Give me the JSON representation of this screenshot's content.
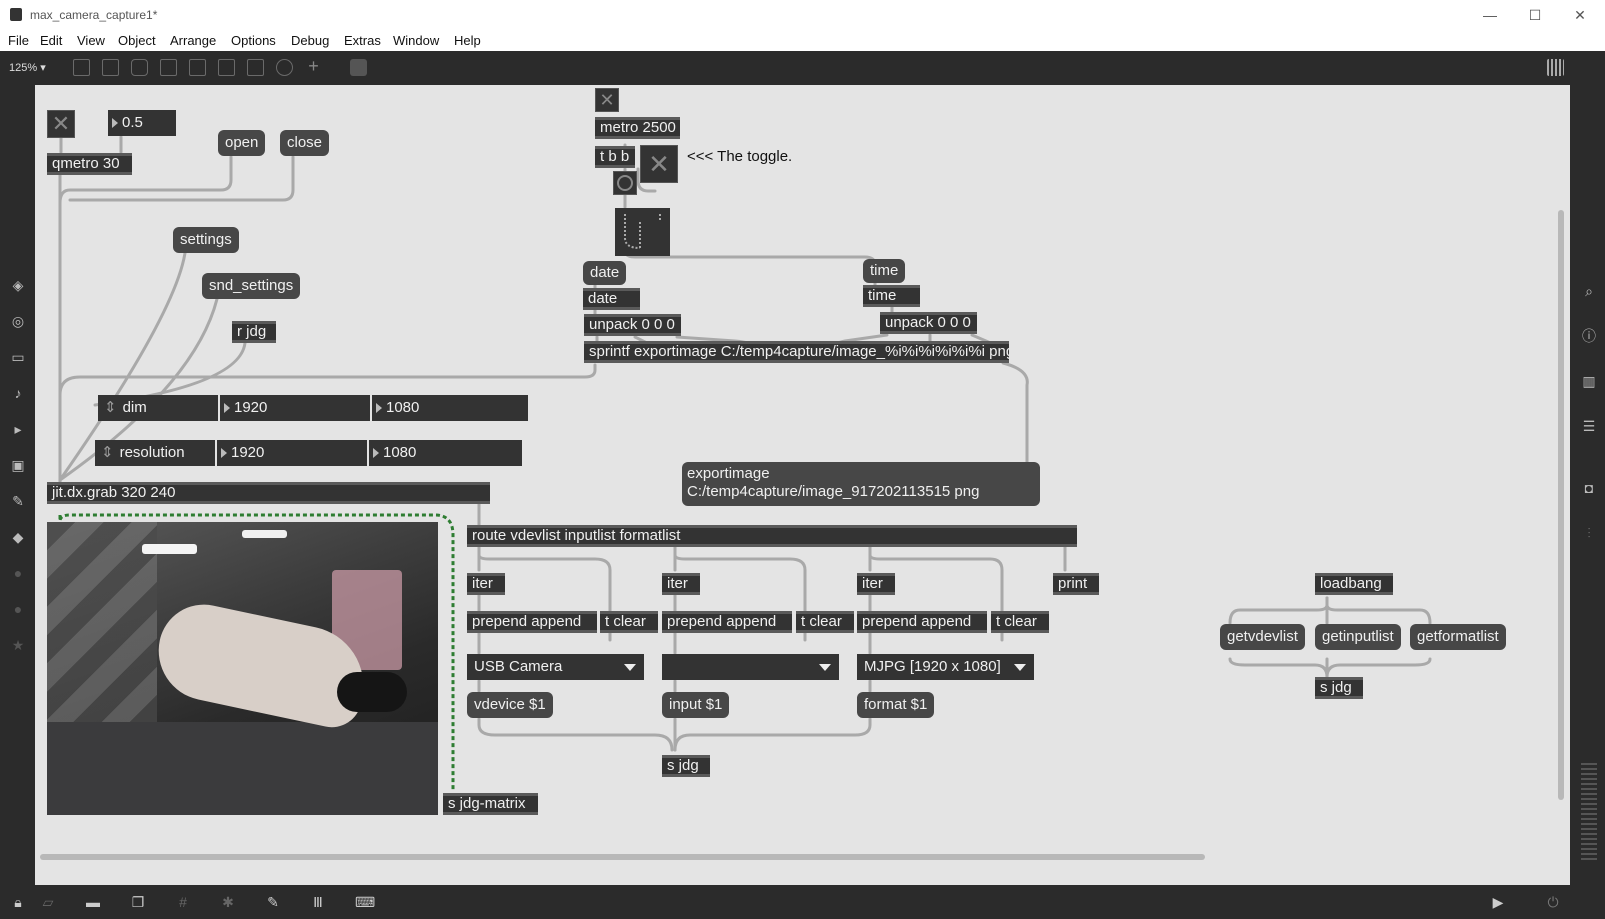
{
  "window": {
    "title": "max_camera_capture1*",
    "controls": [
      "—",
      "☐",
      "✕"
    ]
  },
  "menu": [
    "File",
    "Edit",
    "View",
    "Object",
    "Arrange",
    "Options",
    "Debug",
    "Extras",
    "Window",
    "Help"
  ],
  "toolbar": {
    "zoom": "125% ▾"
  },
  "patch": {
    "toggle_glyph": "✕",
    "float_value": "0.5",
    "qmetro": "qmetro 30",
    "open": "open",
    "close": "close",
    "settings": "settings",
    "snd_settings": "snd_settings",
    "r_jdg": "r jdg",
    "dim": {
      "label": "dim",
      "w": "1920",
      "h": "1080"
    },
    "resolution": {
      "label": "resolution",
      "w": "1920",
      "h": "1080"
    },
    "grab": "jit.dx.grab 320 240",
    "s_jdg_matrix": "s jdg-matrix",
    "metro": "metro 2500",
    "tbb": "t b b",
    "toggle_comment": "<<< The toggle.",
    "date_msg": "date",
    "date_obj": "date",
    "time_msg": "time",
    "time_obj": "time",
    "unpack1": "unpack 0 0 0",
    "unpack2": "unpack 0 0 0",
    "sprintf": "sprintf exportimage C:/temp4capture/image_%i%i%i%i%i%i png",
    "exportimage": "exportimage C:/temp4capture/image_917202113515 png",
    "route": "route vdevlist inputlist formatlist",
    "iter": "iter",
    "prepend": "prepend append",
    "tclear": "t clear",
    "print": "print",
    "menu1": "USB Camera",
    "menu2": "",
    "menu3": "MJPG [1920 x 1080]",
    "vdevice": "vdevice $1",
    "input": "input $1",
    "format": "format $1",
    "s_jdg": "s jdg",
    "loadbang": "loadbang",
    "getvdevlist": "getvdevlist",
    "getinputlist": "getinputlist",
    "getformatlist": "getformatlist",
    "s_jdg2": "s jdg"
  },
  "colors": {
    "canvas": "#e4e4e4",
    "object": "#333333",
    "message": "#474747",
    "chrome": "#2b2b2b",
    "matrix_cord": "#2e7d32"
  }
}
